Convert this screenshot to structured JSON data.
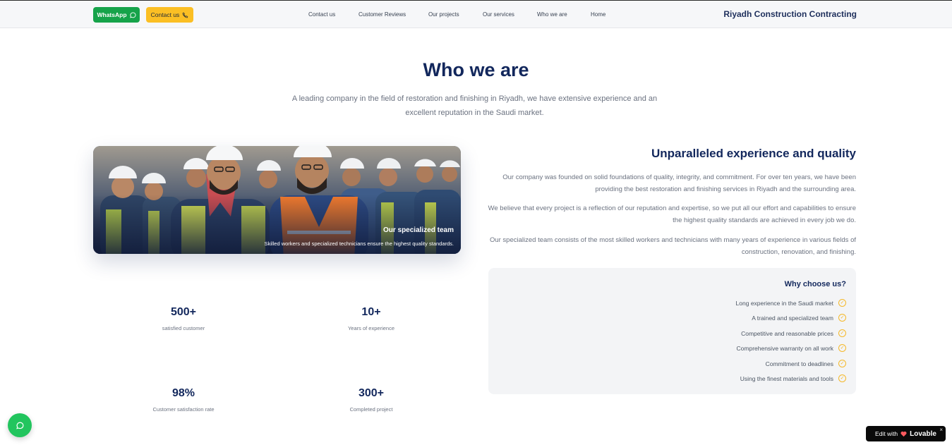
{
  "header": {
    "whatsapp_label": "WhatsApp",
    "contact_label": "Contact us",
    "nav": [
      "Contact us",
      "Customer Reviews",
      "Our projects",
      "Our services",
      "Who we are",
      "Home"
    ],
    "brand": "Riyadh Construction Contracting"
  },
  "section": {
    "title": "Who we are",
    "subtitle": "A leading company in the field of restoration and finishing in Riyadh, we have extensive experience and an excellent reputation in the Saudi market."
  },
  "photo": {
    "title": "Our specialized team",
    "caption": "Skilled workers and specialized technicians ensure the highest quality standards."
  },
  "stats": [
    {
      "value": "500+",
      "label": "satisfied customer"
    },
    {
      "value": "10+",
      "label": "Years of experience"
    },
    {
      "value": "98%",
      "label": "Customer satisfaction rate"
    },
    {
      "value": "300+",
      "label": "Completed project"
    }
  ],
  "about": {
    "heading": "Unparalleled experience and quality",
    "paragraphs": [
      "Our company was founded on solid foundations of quality, integrity, and commitment. For over ten years, we have been providing the best restoration and finishing services in Riyadh and the surrounding area.",
      "We believe that every project is a reflection of our reputation and expertise, so we put all our effort and capabilities to ensure the highest quality standards are achieved in every job we do.",
      "Our specialized team consists of the most skilled workers and technicians with many years of experience in various fields of construction, renovation, and finishing."
    ]
  },
  "why": {
    "title": "Why choose us?",
    "items": [
      "Long experience in the Saudi market",
      "A trained and specialized team",
      "Competitive and reasonable prices",
      "Comprehensive warranty on all work",
      "Commitment to deadlines",
      "Using the finest materials and tools"
    ]
  },
  "badge": {
    "prefix": "Edit with",
    "brand": "Lovable",
    "close": "×"
  },
  "icons": {
    "whatsapp": "chat-bubble-icon",
    "phone": "phone-icon",
    "check": "check-circle-icon"
  },
  "colors": {
    "navy": "#12275c",
    "green": "#16a34a",
    "yellow": "#fbbf24"
  }
}
